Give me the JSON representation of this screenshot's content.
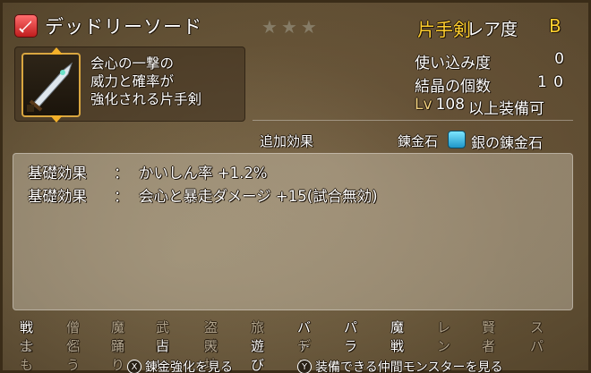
{
  "item": {
    "name": "デッドリーソード",
    "stars": 3,
    "weapon_type": "片手剣",
    "rarity_label": "レア度",
    "rarity_value": "B",
    "description": [
      "会心の一撃の",
      "威力と確率が",
      "強化される片手剣"
    ]
  },
  "stats": {
    "usage_label": "使い込み度",
    "usage_value": "0",
    "crystal_label": "結晶の個数",
    "crystal_value": "1 0",
    "lv_prefix": "Lv",
    "lv_value": "108",
    "lv_suffix": "以上装備可"
  },
  "section": {
    "extra_effects": "追加効果",
    "stone_label": "錬金石",
    "stone_name": "銀の錬金石"
  },
  "effects": [
    {
      "label": "基礎効果",
      "sep": "：",
      "text": "かいしん率 +1.2%"
    },
    {
      "label": "基礎効果",
      "sep": "：",
      "text": "会心と暴走ダメージ +15(試合無効)"
    }
  ],
  "jobs": {
    "row1": [
      {
        "name": "戦士",
        "on": true
      },
      {
        "name": "僧侶",
        "on": false
      },
      {
        "name": "魔使",
        "on": false
      },
      {
        "name": "武闘",
        "on": false
      },
      {
        "name": "盗賊",
        "on": false
      },
      {
        "name": "旅芸",
        "on": false
      },
      {
        "name": "バト",
        "on": true
      },
      {
        "name": "パラ",
        "on": true
      },
      {
        "name": "魔戦",
        "on": true
      },
      {
        "name": "レン",
        "on": false
      },
      {
        "name": "賢者",
        "on": false
      },
      {
        "name": "スパ",
        "on": false
      }
    ],
    "row2": [
      {
        "name": "まも",
        "on": false
      },
      {
        "name": "どう",
        "on": false
      },
      {
        "name": "踊り",
        "on": false
      },
      {
        "name": "占い",
        "on": true
      },
      {
        "name": "天地",
        "on": false
      },
      {
        "name": "遊び",
        "on": true
      },
      {
        "name": "デス",
        "on": false
      }
    ]
  },
  "footer": {
    "left_button": "X",
    "left_text": "錬金強化を見る",
    "right_button": "Y",
    "right_text": "装備できる仲間モンスターを見る"
  },
  "colors": {
    "accent": "#ffcf2e",
    "rarity": "#ffcf2e",
    "stone": "#34b4e0"
  }
}
